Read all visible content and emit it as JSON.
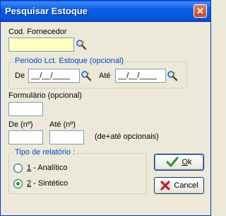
{
  "window": {
    "title": "Pesquisar Estoque",
    "close_glyph": "✕"
  },
  "supplier": {
    "label": "Cod. Fornecedor",
    "value": "",
    "icon": "lookup-icon"
  },
  "period": {
    "group_title": "Período Lct. Estoque (opcional)",
    "from_label": "De",
    "from_value": "__/__/____",
    "to_label": "Até",
    "to_value": "__/__/____"
  },
  "form": {
    "label": "Formulário (opcional)",
    "value": ""
  },
  "number_range": {
    "from_label": "De (nº)",
    "to_label": "Até (nº)",
    "from_value": "",
    "to_value": "",
    "note": "(de+até opcionais)"
  },
  "report_type": {
    "group_title": "Tipo de relatório :",
    "options": [
      {
        "key": "1",
        "label": " - Analítico",
        "selected": false
      },
      {
        "key": "2",
        "label": " - Sintético",
        "selected": true
      }
    ]
  },
  "buttons": {
    "ok": {
      "key": "O",
      "rest": "k"
    },
    "cancel": {
      "label": "Cancel"
    }
  },
  "colors": {
    "title_bar": "#0a5ee6",
    "group_title": "#0046d5",
    "supplier_field_bg": "#ffffc0",
    "ok_icon": "#2d9b2d",
    "cancel_icon": "#c81c1c"
  }
}
